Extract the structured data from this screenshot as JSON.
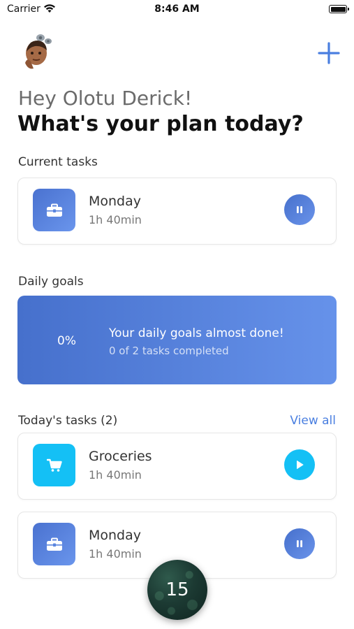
{
  "status_bar": {
    "carrier": "Carrier",
    "time": "8:46 AM"
  },
  "header": {
    "greeting": "Hey Olotu Derick!",
    "headline": "What's your plan today?"
  },
  "current_tasks": {
    "label": "Current tasks",
    "task": {
      "title": "Monday",
      "duration": "1h 40min",
      "icon": "briefcase-icon",
      "control": "pause-icon"
    }
  },
  "daily_goals": {
    "label": "Daily goals",
    "percent": "0%",
    "title": "Your daily goals almost done!",
    "subtitle": "0 of 2 tasks completed"
  },
  "todays_tasks": {
    "label": "Today's tasks (2)",
    "view_all": "View all",
    "items": [
      {
        "title": "Groceries",
        "duration": "1h 40min",
        "icon": "shopping-cart-icon",
        "control": "play-icon"
      },
      {
        "title": "Monday",
        "duration": "1h 40min",
        "icon": "briefcase-icon",
        "control": "pause-icon"
      }
    ]
  },
  "fab": {
    "label": "15"
  },
  "colors": {
    "accent_blue": "#4a7fe0",
    "tile_blue": "#4a72d0",
    "tile_cyan": "#14c0f5"
  }
}
